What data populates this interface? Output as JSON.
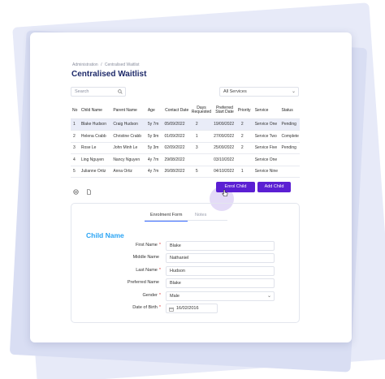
{
  "breadcrumb": [
    "Administration",
    "/",
    "Centralised Waitlist"
  ],
  "page_title": "Centralised Waitlist",
  "search": {
    "placeholder": "Search"
  },
  "services_filter": {
    "selected": "All Services"
  },
  "table": {
    "headers": [
      "No",
      "Child Name",
      "Parent Name",
      "Age",
      "Contact Date",
      "Days Requested",
      "Preferred Start Date",
      "Priority",
      "Service",
      "Status"
    ],
    "rows": [
      [
        "1",
        "Blake Hudson",
        "Craig Hudson",
        "5y 7m",
        "05/09/2022",
        "2",
        "19/09/2022",
        "2",
        "Service One",
        "Pending"
      ],
      [
        "2",
        "Helena Crabb",
        "Christine Crabb",
        "5y 9m",
        "01/09/2022",
        "1",
        "27/09/2022",
        "2",
        "Service Two",
        "Complete"
      ],
      [
        "3",
        "Rose Le",
        "John Minh Le",
        "5y 3m",
        "02/09/2022",
        "3",
        "25/09/2022",
        "2",
        "Service Five",
        "Pending"
      ],
      [
        "4",
        "Ling Nguyen",
        "Nancy Nguyen",
        "4y 7m",
        "29/08/2022",
        "",
        "03/10/2022",
        "",
        "Service One",
        ""
      ],
      [
        "5",
        "Julianne Ortiz",
        "Anna Ortiz",
        "4y 7m",
        "26/08/2022",
        "5",
        "04/10/2022",
        "1",
        "Service Nine",
        ""
      ]
    ]
  },
  "buttons": {
    "enrol": "Enrol Child",
    "add": "Add Child"
  },
  "tabs": [
    "Enrolment Form",
    "Notes"
  ],
  "form": {
    "title": "Child Name",
    "fields": [
      {
        "label": "First Name",
        "required": "*",
        "value": "Blake"
      },
      {
        "label": "Middle Name",
        "required": "",
        "value": "Nathaniel"
      },
      {
        "label": "Last Name",
        "required": "*",
        "value": "Hudson"
      },
      {
        "label": "Preferred Name",
        "required": "",
        "value": "Blake"
      },
      {
        "label": "Gender",
        "required": "*",
        "value": "Male"
      },
      {
        "label": "Date of Birth",
        "required": "*",
        "value": "16/02/2016"
      }
    ]
  },
  "colors": {
    "primary": "#5b1fd3",
    "title": "#1e2a6a",
    "accent": "#2aa4f4",
    "selected_row": "#e9ecf8"
  },
  "icons": [
    "search-icon",
    "chevron-down-icon",
    "print-icon",
    "document-icon",
    "calendar-icon",
    "pointer-cursor-icon"
  ]
}
